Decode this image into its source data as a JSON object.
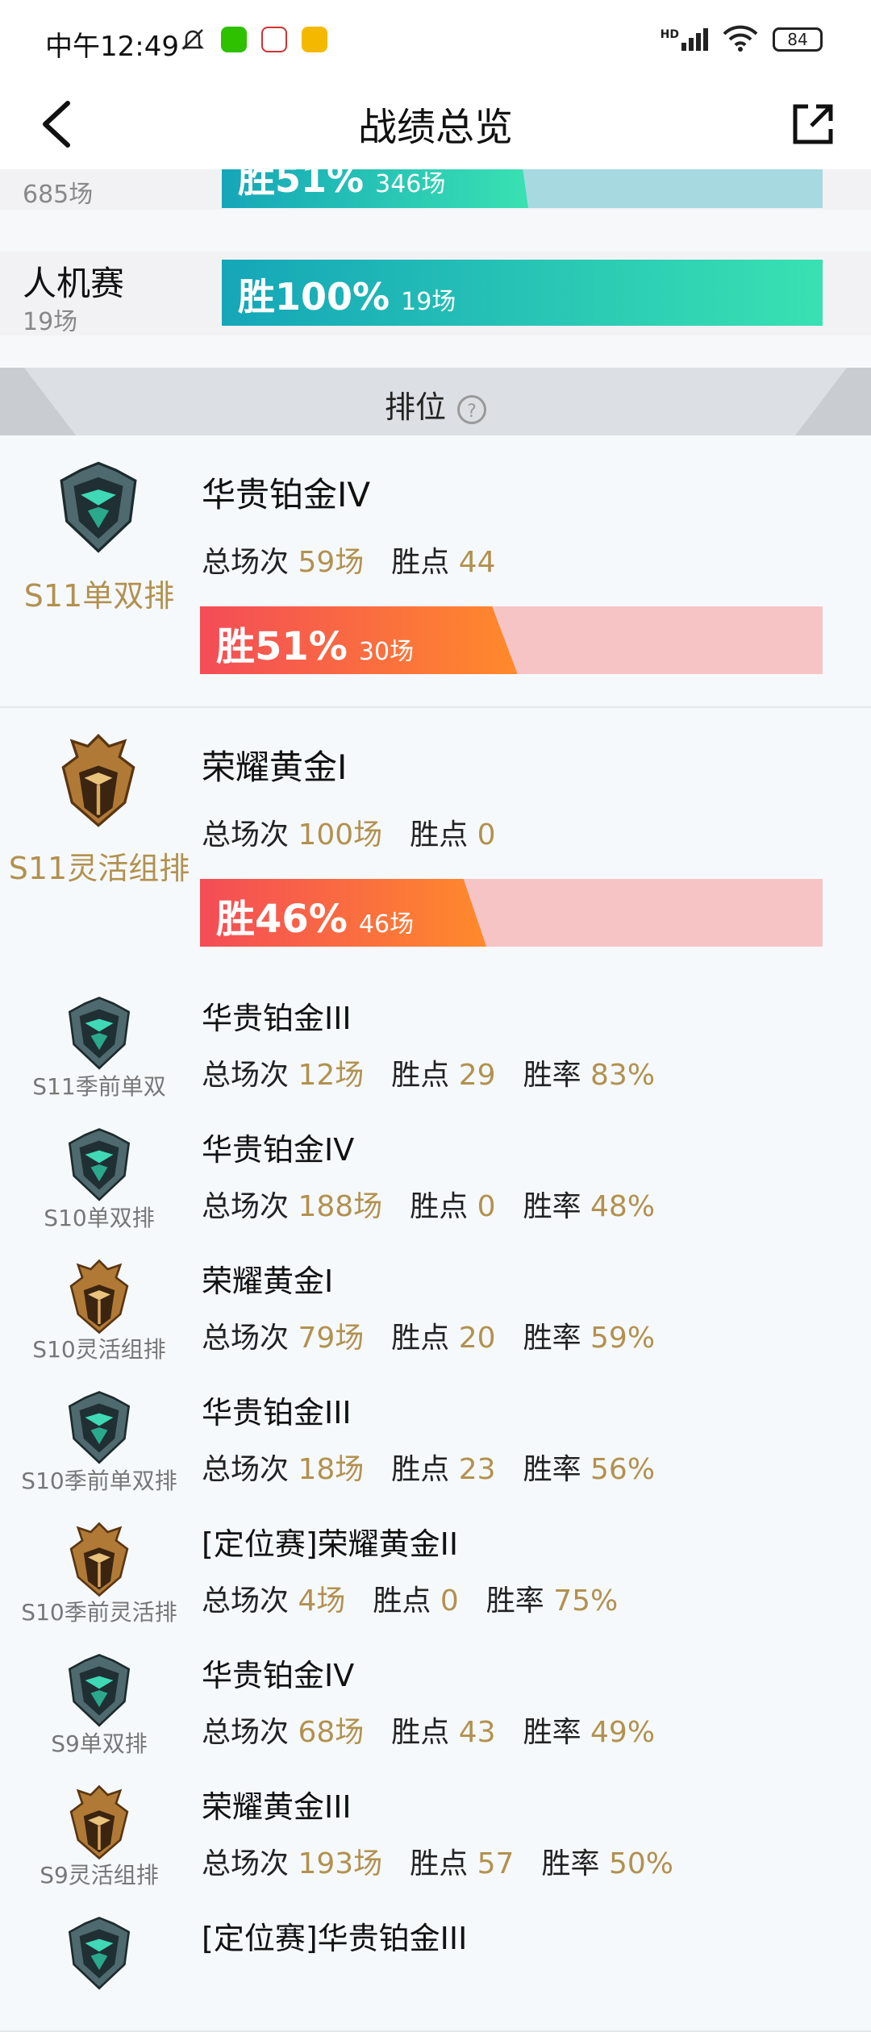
{
  "status_bar": {
    "time": "中午12:49",
    "battery": "84",
    "signal_label": "HD"
  },
  "nav": {
    "title": "战绩总览"
  },
  "modes": [
    {
      "name": "",
      "count": "685场",
      "win_pct_label": "胜51%",
      "games_label": "346场",
      "win_rate": 0.51
    },
    {
      "name": "人机赛",
      "count": "19场",
      "win_pct_label": "胜100%",
      "games_label": "19场",
      "win_rate": 1.0
    }
  ],
  "ranked_header": {
    "label": "排位",
    "help": "?"
  },
  "big_cards": [
    {
      "season": "S11单双排",
      "rank": "华贵铂金IV",
      "total_label": "总场次",
      "total": "59场",
      "lp_label": "胜点",
      "lp": "44",
      "win_pct_label": "胜51%",
      "wins_label": "30场",
      "win_rate": 0.51,
      "tier": "platinum"
    },
    {
      "season": "S11灵活组排",
      "rank": "荣耀黄金I",
      "total_label": "总场次",
      "total": "100场",
      "lp_label": "胜点",
      "lp": "0",
      "win_pct_label": "胜46%",
      "wins_label": "46场",
      "win_rate": 0.46,
      "tier": "gold"
    }
  ],
  "small_cards": [
    {
      "season": "S11季前单双",
      "rank": "华贵铂金III",
      "total": "12场",
      "lp": "29",
      "wr": "83%",
      "tier": "platinum"
    },
    {
      "season": "S10单双排",
      "rank": "华贵铂金IV",
      "total": "188场",
      "lp": "0",
      "wr": "48%",
      "tier": "platinum"
    },
    {
      "season": "S10灵活组排",
      "rank": "荣耀黄金I",
      "total": "79场",
      "lp": "20",
      "wr": "59%",
      "tier": "gold"
    },
    {
      "season": "S10季前单双排",
      "rank": "华贵铂金III",
      "total": "18场",
      "lp": "23",
      "wr": "56%",
      "tier": "platinum"
    },
    {
      "season": "S10季前灵活排",
      "rank": "[定位赛]荣耀黄金II",
      "total": "4场",
      "lp": "0",
      "wr": "75%",
      "tier": "gold"
    },
    {
      "season": "S9单双排",
      "rank": "华贵铂金IV",
      "total": "68场",
      "lp": "43",
      "wr": "49%",
      "tier": "platinum"
    },
    {
      "season": "S9灵活组排",
      "rank": "荣耀黄金III",
      "total": "193场",
      "lp": "57",
      "wr": "50%",
      "tier": "gold"
    },
    {
      "season": "",
      "rank": "[定位赛]华贵铂金III",
      "total": "",
      "lp": "",
      "wr": "",
      "tier": "platinum"
    }
  ],
  "labels": {
    "total": "总场次",
    "lp": "胜点",
    "wr": "胜率"
  },
  "colors": {
    "gold_text": "#b2914f",
    "teal": "#1fb8b8",
    "red": "#f44c57"
  }
}
